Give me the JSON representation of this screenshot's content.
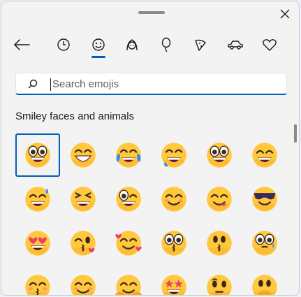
{
  "window": {
    "grip_icon": "drag-handle",
    "close_icon": "close-icon"
  },
  "nav": {
    "back_icon": "back-arrow-icon",
    "tabs": [
      {
        "name": "recently-used",
        "icon": "clock-icon",
        "selected": false
      },
      {
        "name": "emoji",
        "icon": "smiley-icon",
        "selected": true
      },
      {
        "name": "people",
        "icon": "person-icon",
        "selected": false
      },
      {
        "name": "celebrations-and-objects",
        "icon": "balloon-icon",
        "selected": false
      },
      {
        "name": "food-and-plants",
        "icon": "pizza-icon",
        "selected": false
      },
      {
        "name": "transportation-and-places",
        "icon": "car-icon",
        "selected": false
      },
      {
        "name": "symbols",
        "icon": "heart-icon",
        "selected": false
      }
    ]
  },
  "search": {
    "placeholder": "Search emojis",
    "value": ""
  },
  "section": {
    "title": "Smiley faces and animals"
  },
  "emojis": [
    "grinning-face",
    "grinning-face-with-big-eyes",
    "face-with-tears-of-joy",
    "rolling-on-the-floor-laughing",
    "grinning-face-big-eyes-2",
    "grinning-face-with-smiling-eyes",
    "grinning-face-with-sweat",
    "grinning-squinting-face",
    "winking-face",
    "smiling-face-with-smiling-eyes",
    "face-savoring-food",
    "smiling-face-with-sunglasses",
    "smiling-face-with-heart-eyes",
    "face-blowing-a-kiss",
    "smiling-face-with-hearts",
    "kissing-face",
    "kissing-face-2",
    "kissing-face-with-smiling-eyes",
    "kissing-face-with-closed-eyes",
    "smiling-face-with-blush",
    "hugging-face",
    "star-struck",
    "thinking-face",
    "face-with-hand-over-mouth"
  ],
  "colors": {
    "accent": "#005fb8",
    "panel": "#f3f3f3",
    "emoji_face": "#ffc83d",
    "emoji_face_dark": "#f5a623"
  }
}
